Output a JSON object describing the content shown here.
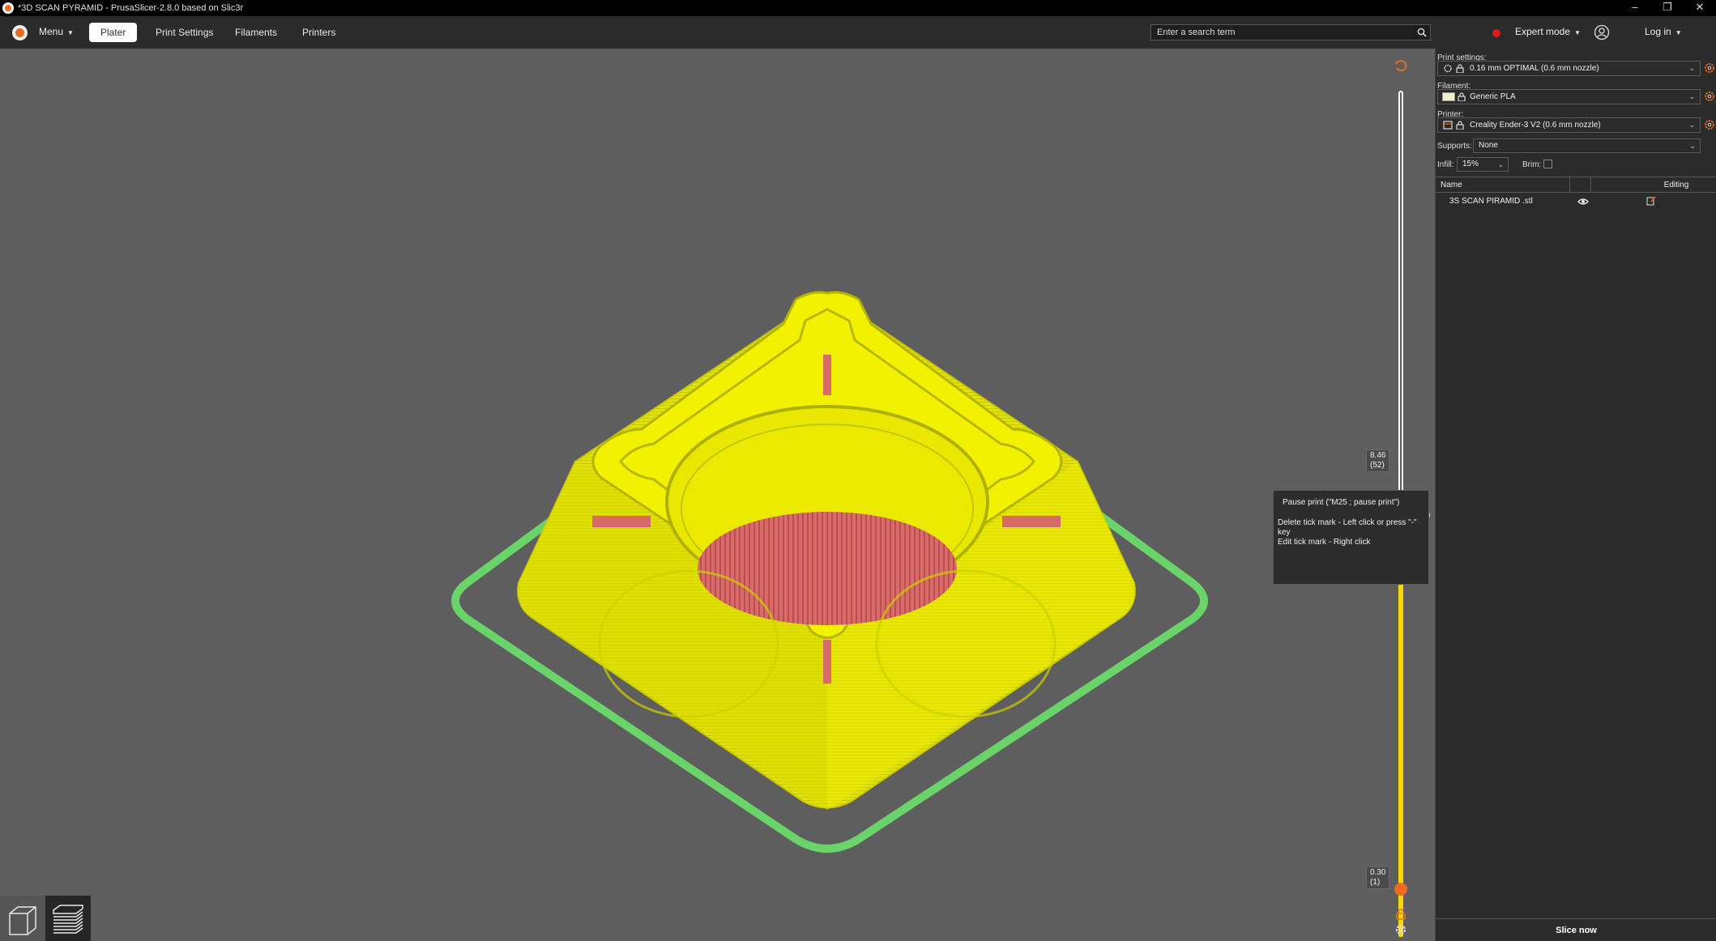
{
  "window": {
    "title": "*3D SCAN PYRAMID - PrusaSlicer-2.8.0 based on Slic3r",
    "controls": [
      "–",
      "❐",
      "✕"
    ]
  },
  "toolbar": {
    "menu_label": "Menu",
    "tabs": [
      {
        "label": "Plater",
        "active": true
      },
      {
        "label": "Print Settings",
        "active": false
      },
      {
        "label": "Filaments",
        "active": false
      },
      {
        "label": "Printers",
        "active": false
      }
    ],
    "search_placeholder": "Enter a search term",
    "mode_label": "Expert mode",
    "mode_color": "#e01a1a",
    "login_label": "Log in"
  },
  "slider": {
    "upper_value": "8.46",
    "upper_layer": "(52)",
    "lower_value": "0.30",
    "lower_layer": "(1)",
    "tooltip": {
      "line1": "Pause print (\"M25 ; pause print\")",
      "line2": "Delete tick mark - Left click or press \"-\" key",
      "line3": "Edit tick mark - Right click"
    }
  },
  "sidebar": {
    "print_settings_label": "Print settings:",
    "print_settings_value": "0.16 mm OPTIMAL (0.6 mm nozzle)",
    "filament_label": "Filament:",
    "filament_value": "Generic PLA",
    "filament_color": "#f0f0c8",
    "printer_label": "Printer:",
    "printer_value": "Creality Ender-3 V2 (0.6 mm nozzle)",
    "supports_label": "Supports:",
    "supports_value": "None",
    "infill_label": "Infill:",
    "infill_value": "15%",
    "brim_label": "Brim:",
    "brim_checked": false,
    "object_list": {
      "col_name": "Name",
      "col_editing": "Editing",
      "rows": [
        {
          "name": "3S SCAN PIRAMID .stl"
        }
      ]
    },
    "slice_button": "Slice now"
  },
  "colors": {
    "accent": "#ed6b21",
    "model_yellow": "#e6e600",
    "skirt_green": "#6ad36a",
    "infill_red": "#d76565",
    "viewport_bg": "#5e5e5e"
  }
}
